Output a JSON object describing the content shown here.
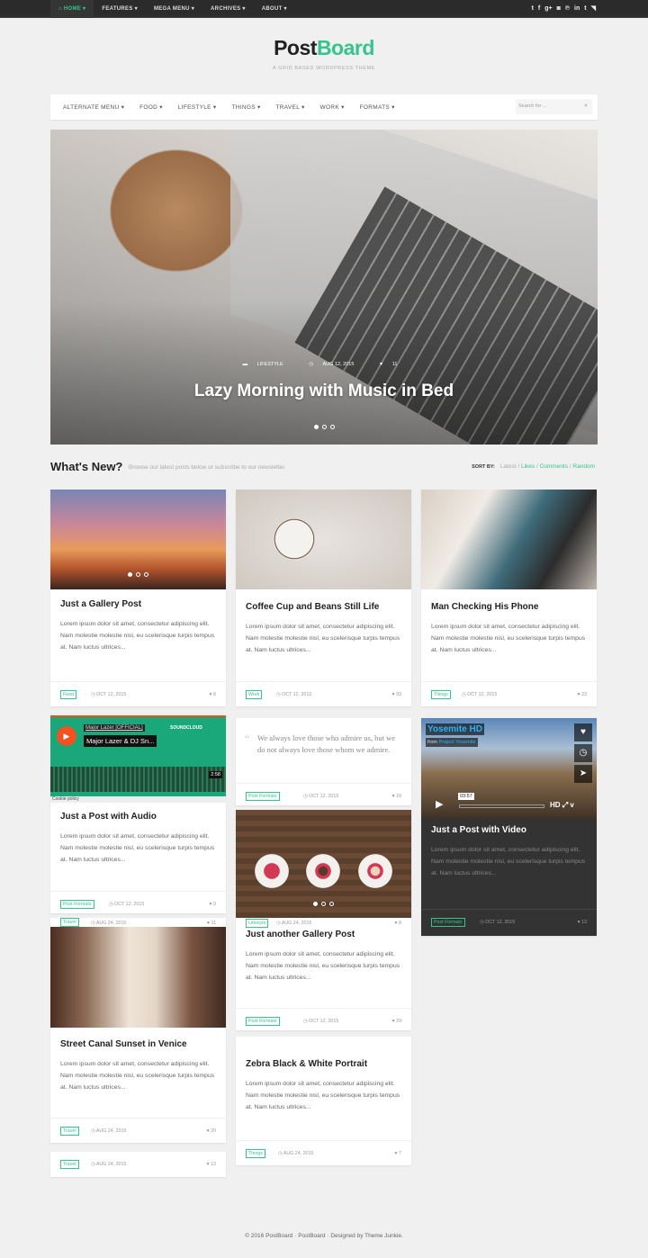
{
  "topbar": {
    "nav": [
      "⌂ HOME ▾",
      "FEATURES ▾",
      "MEGA MENU ▾",
      "ARCHIVES ▾",
      "ABOUT ▾"
    ],
    "social": [
      "twitter-icon",
      "facebook-icon",
      "google-plus-icon",
      "instagram-icon",
      "pinterest-icon",
      "linkedin-icon",
      "tumblr-icon",
      "rss-icon"
    ]
  },
  "brand": {
    "name_dark": "Post",
    "name_accent": "Board",
    "tagline": "A GRID BASED WORDPRESS THEME",
    "accent": "#36c48e"
  },
  "mainnav": {
    "items": [
      "ALTERNATE MENU ▾",
      "FOOD ▾",
      "LIFESTYLE ▾",
      "THINGS ▾",
      "TRAVEL ▾",
      "WORK ▾",
      "FORMATS ▾"
    ],
    "search_placeholder": "Search for ..."
  },
  "hero": {
    "category": "LIFESTYLE",
    "date": "AUG 12, 2015",
    "likes": "11",
    "title": "Lazy Morning with Music in Bed"
  },
  "section": {
    "title": "What's New?",
    "subtitle": "Browse our latest posts below or subscribe to our newsletter",
    "sort_label": "SORT BY:",
    "sort": [
      "Latest",
      "Likes",
      "Comments",
      "Random"
    ]
  },
  "excerpt": "Lorem ipsum dolor sit amet, consectetur adipiscing elit. Nam molestie molestie nisl, eu scelerisque turpis tempus at. Nam luctus ultrices...",
  "posts": [
    {
      "title": "Just a Gallery Post",
      "tag": "Food",
      "date": "OCT 12, 2015",
      "likes": "8"
    },
    {
      "title": "Coffee Cup and Beans Still Life",
      "tag": "Work",
      "date": "OCT 12, 2015",
      "likes": "93"
    },
    {
      "title": "Man Checking His Phone",
      "tag": "Things",
      "date": "OCT 12, 2015",
      "likes": "23"
    },
    {
      "title": "Just a Post with Audio",
      "tag": "Post Formats",
      "date": "OCT 12, 2015",
      "likes": "9",
      "embed_artist": "Major Lazer [OFFICIAL]",
      "embed_track": "Major Lazer & DJ Sn...",
      "embed_brand": "SOUNDCLOUD",
      "embed_time": "2:58",
      "cookie": "Cookie policy"
    },
    {
      "quote": "We always love those who admire us, but we do not always love those whom we admire.",
      "tag": "Post Formats",
      "date": "OCT 12, 2015",
      "likes": "19"
    },
    {
      "title": "Just a Post with Video",
      "tag": "Post Formats",
      "date": "OCT 12, 2015",
      "likes": "13",
      "video_title": "Yosemite HD",
      "video_from": "from",
      "video_channel": "Project Yosemite",
      "video_time": "03:57",
      "video_hd": "HD"
    },
    {
      "title": "Just another Gallery Post",
      "tag": "Post Formats",
      "date": "OCT 12, 2015",
      "likes": "29",
      "overlay_tag": "Lifestyle",
      "overlay_date": "AUG 24, 2015",
      "overlay_likes": "8"
    },
    {
      "title": "Street Canal Sunset in Venice",
      "tag": "Travel",
      "date": "AUG 24, 2015",
      "likes": "20",
      "overlay_tag": "Travel",
      "overlay_date": "AUG 24, 2015",
      "overlay_likes": "11"
    },
    {
      "title": "Zebra Black & White Portrait",
      "tag": "Things",
      "date": "AUG 24, 2015",
      "likes": "7"
    },
    {
      "tag": "Travel",
      "date": "AUG 24, 2015",
      "likes": "13"
    }
  ],
  "footer": "© 2016 PostBoard · PostBoard · Designed by Theme Junkie."
}
